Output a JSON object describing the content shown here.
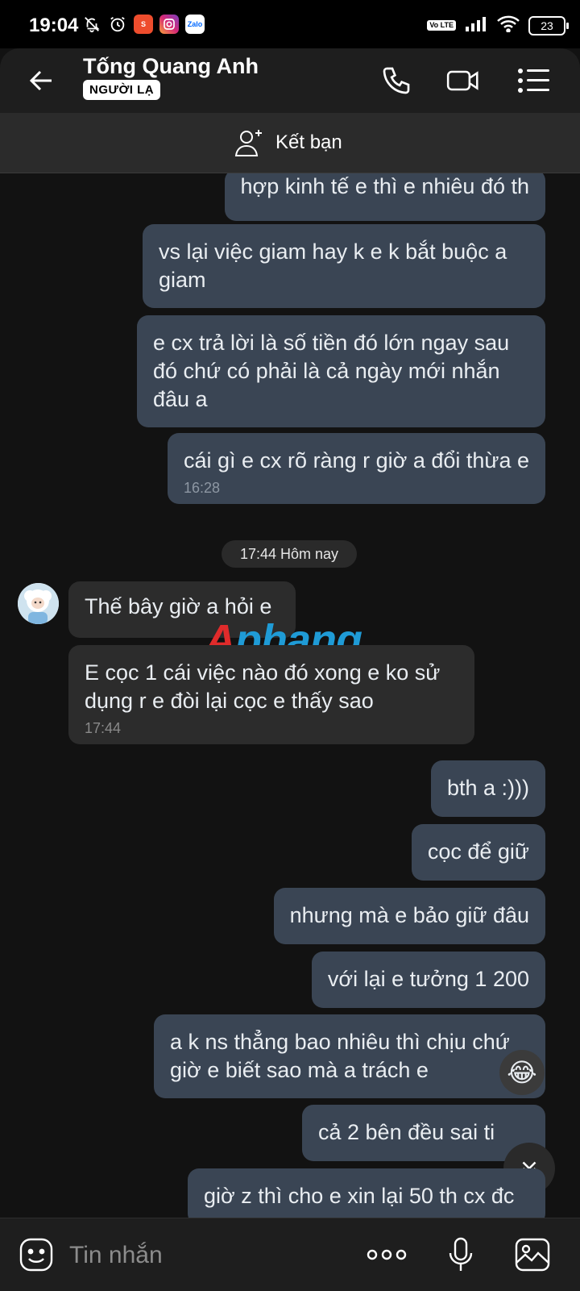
{
  "status_bar": {
    "time": "19:04",
    "battery": "23",
    "network_badge": "Vo LTE",
    "app_badges": [
      "shopee",
      "instagram",
      "Zalo"
    ]
  },
  "header": {
    "name": "Tống Quang Anh",
    "badge": "NGƯỜI LẠ"
  },
  "friend_bar": {
    "label": "Kết bạn"
  },
  "day_separator": "17:44 Hôm nay",
  "watermark": {
    "part1": "A",
    "part2": "phang"
  },
  "messages": [
    {
      "dir": "out",
      "text": "hợp kinh tế e thì e nhiêu đó th",
      "time": ""
    },
    {
      "dir": "out",
      "text": "vs lại việc giam hay k e k bắt buộc a giam",
      "time": ""
    },
    {
      "dir": "out",
      "text": "e cx trả lời là số tiền đó lớn ngay sau đó chứ có phải là cả ngày mới nhắn đâu a",
      "time": ""
    },
    {
      "dir": "out",
      "text": "cái gì e cx rõ ràng r giờ a đổi thừa e",
      "time": "16:28"
    },
    {
      "dir": "in",
      "text": "Thế bây giờ a hỏi e",
      "time": ""
    },
    {
      "dir": "in",
      "text": "E cọc 1 cái việc nào đó xong e ko sử dụng r e đòi lại cọc e thấy sao",
      "time": "17:44"
    },
    {
      "dir": "out",
      "text": "bth a :)))",
      "time": ""
    },
    {
      "dir": "out",
      "text": "cọc để giữ",
      "time": ""
    },
    {
      "dir": "out",
      "text": "nhưng mà e bảo giữ đâu",
      "time": ""
    },
    {
      "dir": "out",
      "text": "với lại e tưởng 1 200",
      "time": ""
    },
    {
      "dir": "out",
      "text": "a k ns thẳng bao nhiêu thì chịu chứ giờ e biết sao mà a trách e",
      "time": ""
    },
    {
      "dir": "out",
      "text": "cả 2 bên đều sai ti",
      "time": ""
    },
    {
      "dir": "out",
      "text": "giờ z thì cho e xin lại 50 th cx đc",
      "time": ""
    }
  ],
  "reaction": "😂",
  "composer": {
    "placeholder": "Tin nhắn"
  },
  "colors": {
    "background": "#121212",
    "outgoing_bubble": "#3a4554",
    "incoming_bubble": "#2c2c2c",
    "header": "#1e1e1e"
  }
}
